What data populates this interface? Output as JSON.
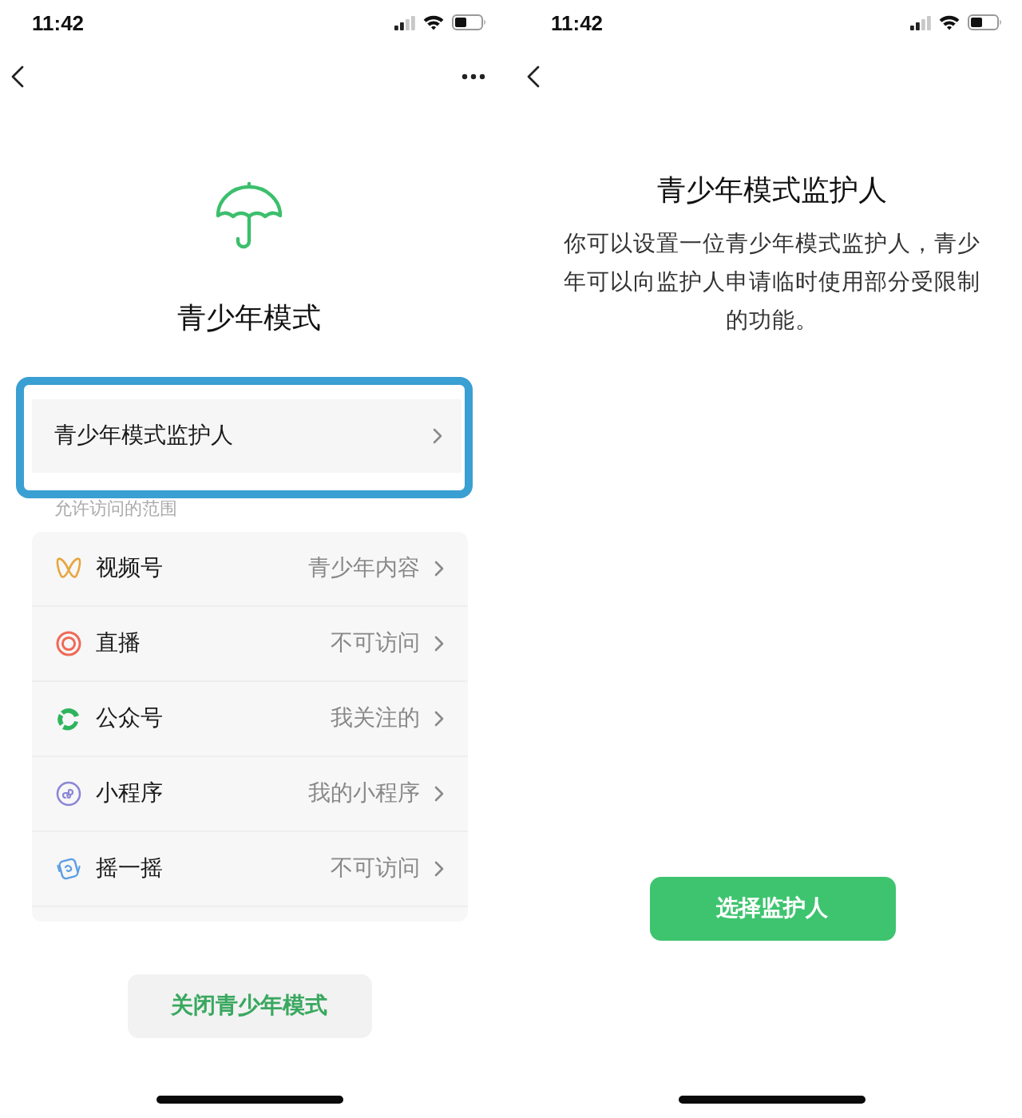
{
  "mode_screen": {
    "status_bar": {
      "time": "11:42"
    },
    "title": "青少年模式",
    "guardian_row": {
      "label": "青少年模式监护人",
      "highlighted": true
    },
    "section_label": "允许访问的范围",
    "scopes": [
      {
        "kind": "channels",
        "name": "视频号",
        "value": "青少年内容"
      },
      {
        "kind": "live",
        "name": "直播",
        "value": "不可访问"
      },
      {
        "kind": "official",
        "name": "公众号",
        "value": "我关注的"
      },
      {
        "kind": "miniprogram",
        "name": "小程序",
        "value": "我的小程序"
      },
      {
        "kind": "shake",
        "name": "摇一摇",
        "value": "不可访问"
      }
    ],
    "close_button": "关闭青少年模式"
  },
  "guardian_screen": {
    "status_bar": {
      "time": "11:42"
    },
    "title": "青少年模式监护人",
    "description": "你可以设置一位青少年模式监护人，青少年可以向监护人申请临时使用部分受限制的功能。",
    "select_button": "选择监护人"
  }
}
